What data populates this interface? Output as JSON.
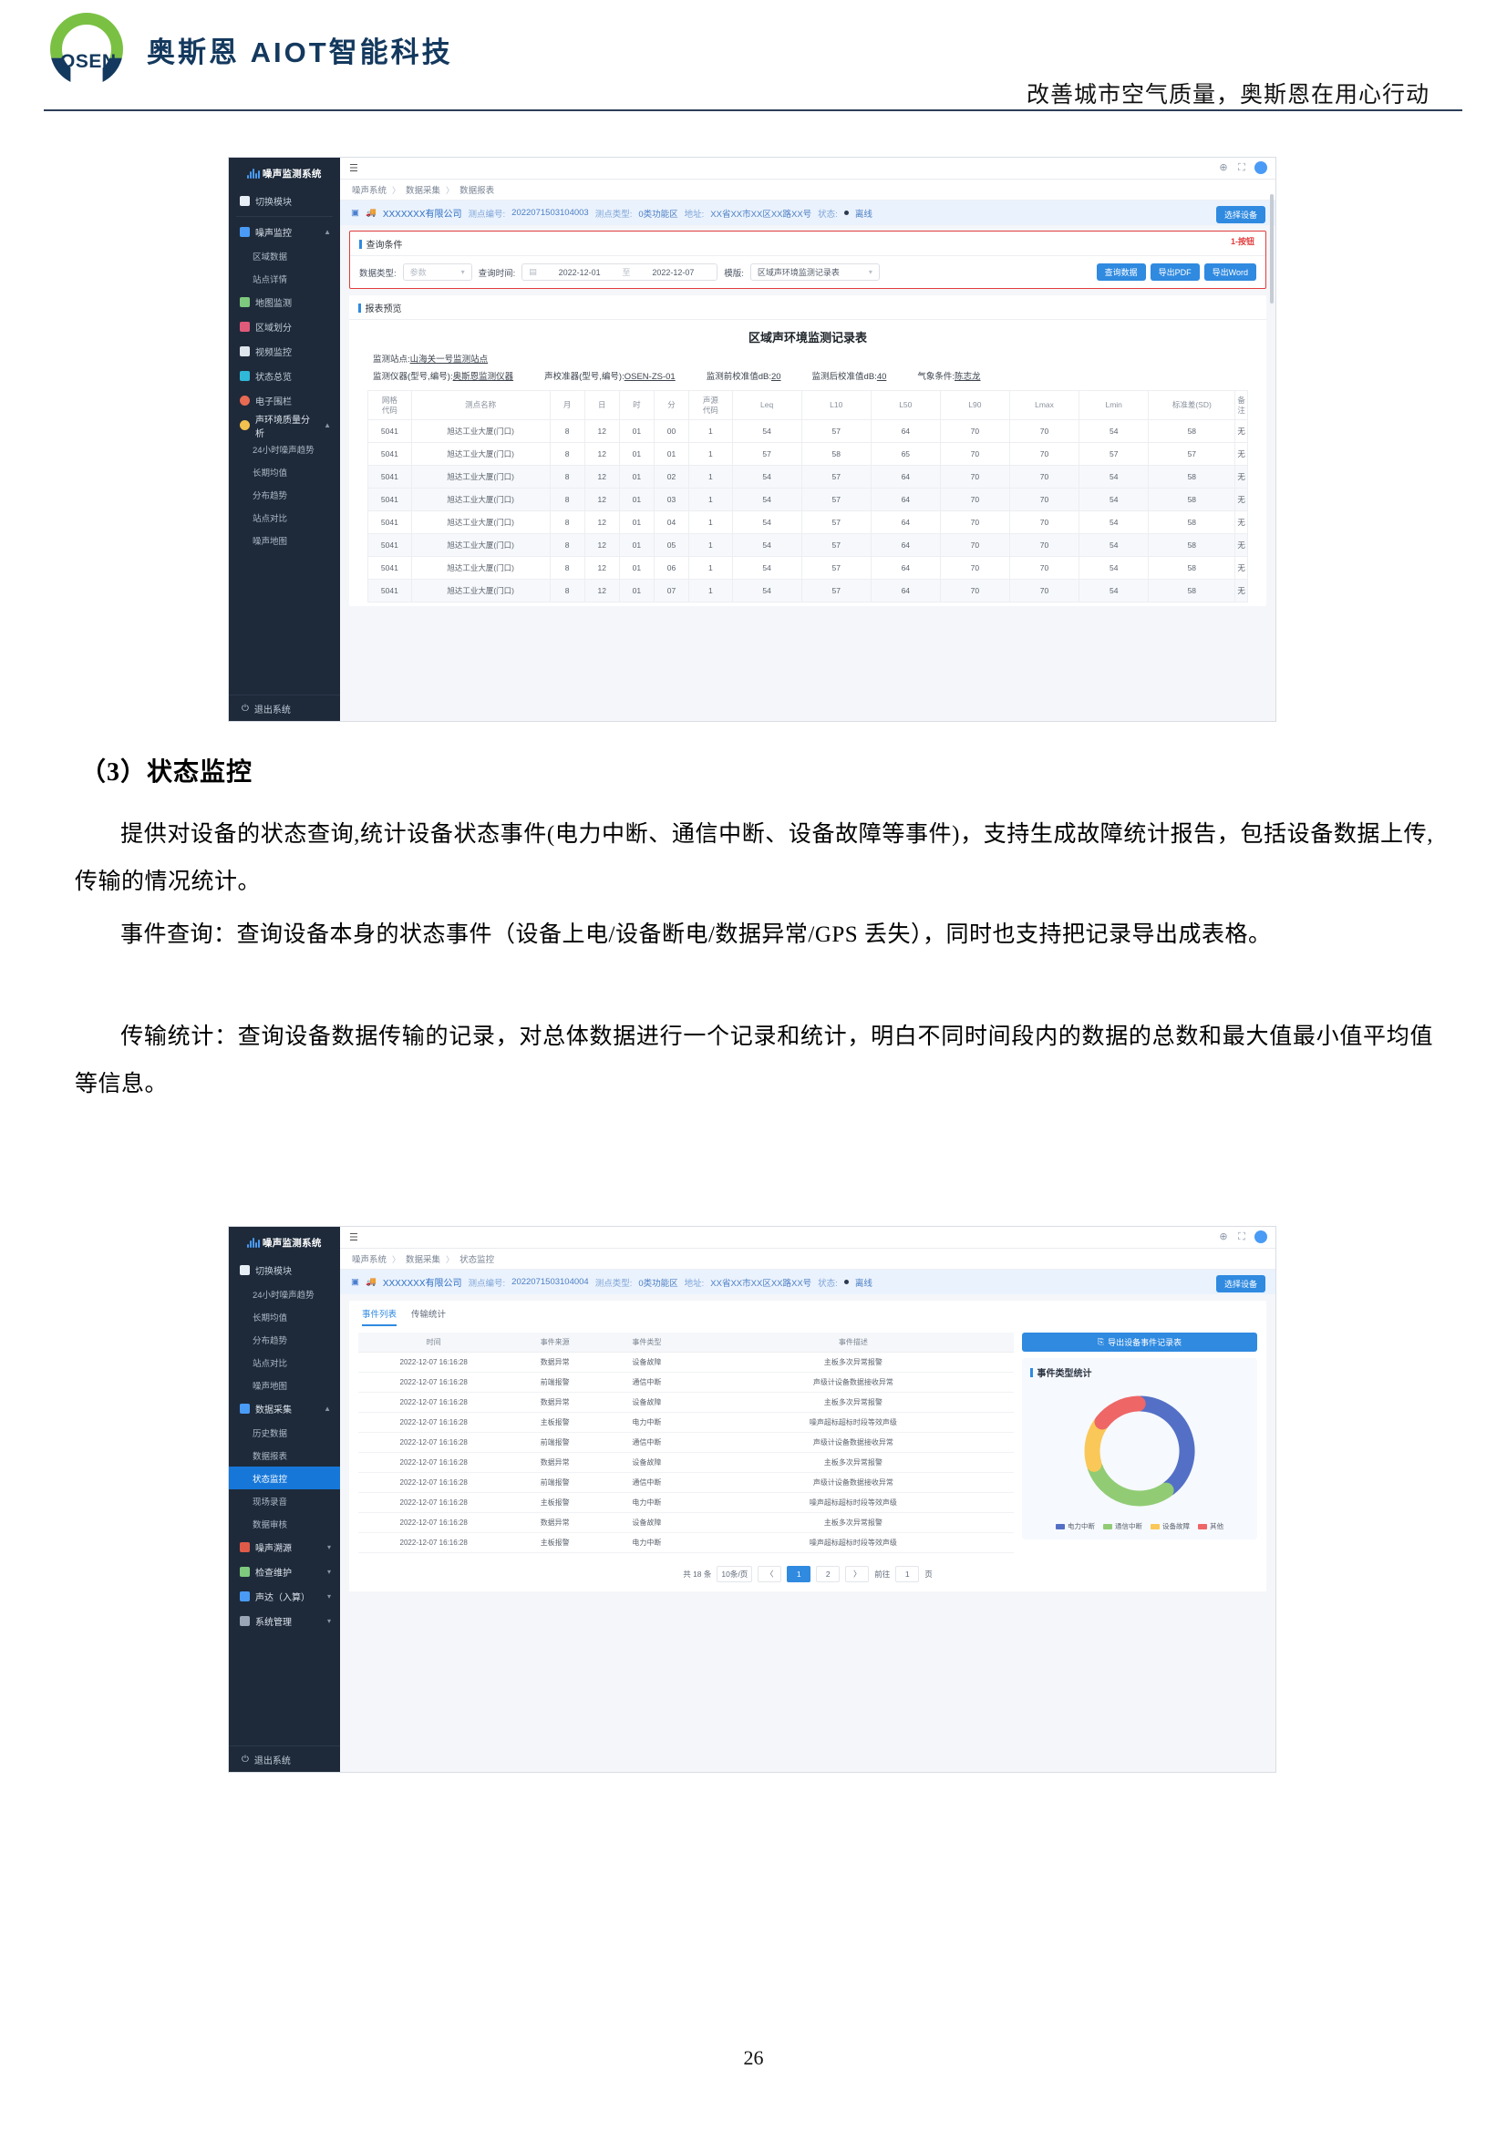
{
  "header": {
    "logo_text": "OSEN",
    "brand": "奥斯恩 AIOT智能科技",
    "tagline": "改善城市空气质量，奥斯恩在用心行动"
  },
  "document": {
    "heading": "（3）状态监控",
    "paragraph1": "提供对设备的状态查询,统计设备状态事件(电力中断、通信中断、设备故障等事件)，支持生成故障统计报告，包括设备数据上传,传输的情况统计。",
    "paragraph2": "事件查询：查询设备本身的状态事件（设备上电/设备断电/数据异常/GPS 丢失），同时也支持把记录导出成表格。",
    "paragraph3": "传输统计：查询设备数据传输的记录，对总体数据进行一个记录和统计，明白不同时间段内的数据的总数和最大值最小值平均值等信息。",
    "page_number": "26"
  },
  "shot1": {
    "sidebar": {
      "title": "噪声监测系统",
      "items": [
        {
          "label": "切换模块",
          "icon": "grid-icon",
          "type": "item",
          "color": "#e8eef6"
        },
        {
          "label": "噪声监控",
          "icon": "monitor-icon",
          "type": "group",
          "color": "#4a9bf5",
          "expanded": true
        },
        {
          "label": "区域数据",
          "icon": "",
          "type": "sub"
        },
        {
          "label": "站点详情",
          "icon": "",
          "type": "sub"
        },
        {
          "label": "地图监测",
          "icon": "map-icon",
          "type": "item",
          "color": "#7ec97e"
        },
        {
          "label": "区域划分",
          "icon": "region-icon",
          "type": "item",
          "color": "#e05a7a"
        },
        {
          "label": "视频监控",
          "icon": "video-icon",
          "type": "item",
          "color": "#dfe5ec"
        },
        {
          "label": "状态总览",
          "icon": "status-icon",
          "type": "item",
          "color": "#2fb8d8"
        },
        {
          "label": "电子围栏",
          "icon": "fence-icon",
          "type": "item",
          "color": "#e86a52"
        },
        {
          "label": "声环境质量分析",
          "icon": "analysis-icon",
          "type": "group",
          "color": "#f2c14e",
          "expanded": true
        },
        {
          "label": "24小时噪声趋势",
          "icon": "",
          "type": "sub"
        },
        {
          "label": "长期均值",
          "icon": "",
          "type": "sub"
        },
        {
          "label": "分布趋势",
          "icon": "",
          "type": "sub"
        },
        {
          "label": "站点对比",
          "icon": "",
          "type": "sub"
        },
        {
          "label": "噪声地图",
          "icon": "",
          "type": "sub"
        }
      ],
      "logout": "退出系统"
    },
    "breadcrumb": [
      "噪声系统",
      "数据采集",
      "数据报表"
    ],
    "device": {
      "company": "XXXXXXX有限公司",
      "station_label": "测点编号:",
      "station_value": "2022071503104003",
      "type_label": "测点类型:",
      "type_value": "0类功能区",
      "addr_label": "地址:",
      "addr_value": "XX省XX市XX区XX路XX号",
      "status_label": "状态:",
      "status_value": "离线",
      "select_device_button": "选择设备"
    },
    "query": {
      "panel_title": "查询条件",
      "annotation": "1-按钮",
      "data_type_label": "数据类型:",
      "data_type_value": "参数",
      "time_label": "查询时间:",
      "time_start": "2022-12-01",
      "time_to": "至",
      "time_end": "2022-12-07",
      "template_label": "模版:",
      "template_value": "区域声环境监测记录表",
      "buttons": [
        "查询数据",
        "导出PDF",
        "导出Word"
      ]
    },
    "report": {
      "panel_title": "报表预览",
      "title": "区域声环境监测记录表",
      "station_line_label": "监测站点:",
      "station_line_value": "山海关一号监测站点",
      "instrument_label": "监测仪器(型号,编号):",
      "instrument_value": "奥斯恩监测仪器",
      "calibrator_label": "声校准器(型号,编号):",
      "calibrator_value": "OSEN-ZS-01",
      "pre_cal_label": "监测前校准值dB:",
      "pre_cal_value": "20",
      "post_cal_label": "监测后校准值dB:",
      "post_cal_value": "40",
      "weather_label": "气象条件:",
      "weather_value": "陈志龙",
      "columns": [
        "网格\n代码",
        "测点名称",
        "月",
        "日",
        "时",
        "分",
        "声源\n代码",
        "Leq",
        "L10",
        "L50",
        "L90",
        "Lmax",
        "Lmin",
        "标准差(SD)",
        "备注"
      ],
      "rows": [
        [
          "5041",
          "旭达工业大厦(门口)",
          "8",
          "12",
          "01",
          "00",
          "1",
          "54",
          "57",
          "64",
          "70",
          "70",
          "54",
          "58",
          "无"
        ],
        [
          "5041",
          "旭达工业大厦(门口)",
          "8",
          "12",
          "01",
          "01",
          "1",
          "57",
          "58",
          "65",
          "70",
          "70",
          "57",
          "57",
          "无"
        ],
        [
          "5041",
          "旭达工业大厦(门口)",
          "8",
          "12",
          "01",
          "02",
          "1",
          "54",
          "57",
          "64",
          "70",
          "70",
          "54",
          "58",
          "无"
        ],
        [
          "5041",
          "旭达工业大厦(门口)",
          "8",
          "12",
          "01",
          "03",
          "1",
          "54",
          "57",
          "64",
          "70",
          "70",
          "54",
          "58",
          "无"
        ],
        [
          "5041",
          "旭达工业大厦(门口)",
          "8",
          "12",
          "01",
          "04",
          "1",
          "54",
          "57",
          "64",
          "70",
          "70",
          "54",
          "58",
          "无"
        ],
        [
          "5041",
          "旭达工业大厦(门口)",
          "8",
          "12",
          "01",
          "05",
          "1",
          "54",
          "57",
          "64",
          "70",
          "70",
          "54",
          "58",
          "无"
        ],
        [
          "5041",
          "旭达工业大厦(门口)",
          "8",
          "12",
          "01",
          "06",
          "1",
          "54",
          "57",
          "64",
          "70",
          "70",
          "54",
          "58",
          "无"
        ],
        [
          "5041",
          "旭达工业大厦(门口)",
          "8",
          "12",
          "01",
          "07",
          "1",
          "54",
          "57",
          "64",
          "70",
          "70",
          "54",
          "58",
          "无"
        ]
      ]
    }
  },
  "shot2": {
    "sidebar": {
      "title": "噪声监测系统",
      "items": [
        {
          "label": "切换模块",
          "icon": "grid-icon",
          "type": "item",
          "color": "#e8eef6"
        },
        {
          "label": "24小时噪声趋势",
          "icon": "",
          "type": "sub"
        },
        {
          "label": "长期均值",
          "icon": "",
          "type": "sub"
        },
        {
          "label": "分布趋势",
          "icon": "",
          "type": "sub"
        },
        {
          "label": "站点对比",
          "icon": "",
          "type": "sub"
        },
        {
          "label": "噪声地图",
          "icon": "",
          "type": "sub"
        },
        {
          "label": "数据采集",
          "icon": "collect-icon",
          "type": "group",
          "color": "#4a9bf5",
          "expanded": true
        },
        {
          "label": "历史数据",
          "icon": "",
          "type": "sub"
        },
        {
          "label": "数据报表",
          "icon": "",
          "type": "sub"
        },
        {
          "label": "状态监控",
          "icon": "",
          "type": "sub",
          "active": true
        },
        {
          "label": "现场录音",
          "icon": "",
          "type": "sub"
        },
        {
          "label": "数据审核",
          "icon": "",
          "type": "sub"
        },
        {
          "label": "噪声溯源",
          "icon": "trace-icon",
          "type": "group",
          "color": "#e05a4a"
        },
        {
          "label": "检查维护",
          "icon": "maintain-icon",
          "type": "group",
          "color": "#7ec97e"
        },
        {
          "label": "声达（入算）",
          "icon": "sound-icon",
          "type": "group",
          "color": "#4a9bf5"
        },
        {
          "label": "系统管理",
          "icon": "system-icon",
          "type": "group",
          "color": "#9aa6b5"
        }
      ],
      "logout": "退出系统"
    },
    "breadcrumb": [
      "噪声系统",
      "数据采集",
      "状态监控"
    ],
    "device": {
      "company": "XXXXXXX有限公司",
      "station_label": "测点编号:",
      "station_value": "2022071503104004",
      "type_label": "测点类型:",
      "type_value": "0类功能区",
      "addr_label": "地址:",
      "addr_value": "XX省XX市XX区XX路XX号",
      "status_label": "状态:",
      "status_value": "离线",
      "select_device_button": "选择设备"
    },
    "tabs": [
      {
        "label": "事件列表",
        "selected": true
      },
      {
        "label": "传输统计",
        "selected": false
      }
    ],
    "export_button": "导出设备事件记录表",
    "table": {
      "columns": [
        "时间",
        "事件来源",
        "事件类型",
        "事件描述"
      ],
      "rows": [
        [
          "2022-12-07 16:16:28",
          "数据异常",
          "设备故障",
          "主板多次异常报警"
        ],
        [
          "2022-12-07 16:16:28",
          "前端报警",
          "通信中断",
          "声级计设备数据接收异常"
        ],
        [
          "2022-12-07 16:16:28",
          "数据异常",
          "设备故障",
          "主板多次异常报警"
        ],
        [
          "2022-12-07 16:16:28",
          "主板报警",
          "电力中断",
          "噪声超标超标时段等效声级"
        ],
        [
          "2022-12-07 16:16:28",
          "前端报警",
          "通信中断",
          "声级计设备数据接收异常"
        ],
        [
          "2022-12-07 16:16:28",
          "数据异常",
          "设备故障",
          "主板多次异常报警"
        ],
        [
          "2022-12-07 16:16:28",
          "前端报警",
          "通信中断",
          "声级计设备数据接收异常"
        ],
        [
          "2022-12-07 16:16:28",
          "主板报警",
          "电力中断",
          "噪声超标超标时段等效声级"
        ],
        [
          "2022-12-07 16:16:28",
          "数据异常",
          "设备故障",
          "主板多次异常报警"
        ],
        [
          "2022-12-07 16:16:28",
          "主板报警",
          "电力中断",
          "噪声超标超标时段等效声级"
        ]
      ]
    },
    "pager": {
      "total": "共 18 条",
      "page_size": "10条/页",
      "prev": "〈",
      "pages": [
        "1",
        "2"
      ],
      "next": "〉",
      "goto_label": "前往",
      "goto_value": "1",
      "goto_suffix": "页"
    },
    "chart_data": {
      "type": "pie",
      "title": "事件类型统计",
      "categories": [
        "电力中断",
        "通信中断",
        "设备故障",
        "其他"
      ],
      "values": [
        40,
        30,
        15,
        15
      ],
      "colors": [
        "#5470c6",
        "#91cc75",
        "#fac858",
        "#ee6666"
      ],
      "legend_position": "bottom",
      "donut": true
    }
  }
}
